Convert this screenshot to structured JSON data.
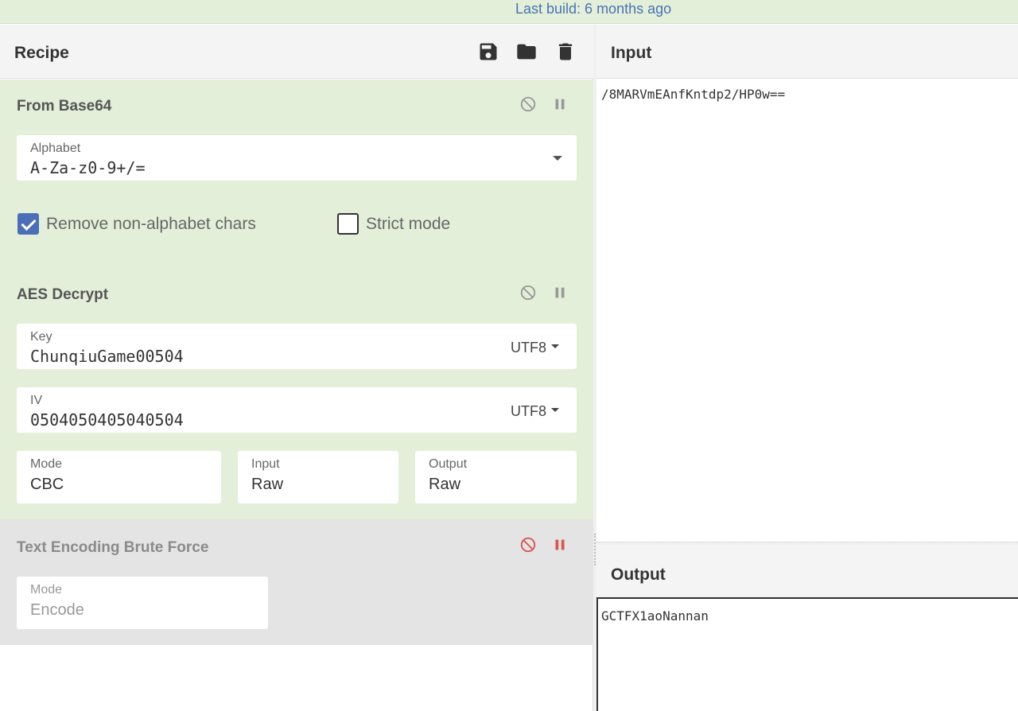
{
  "banner": {
    "last_build": "Last build: 6 months ago"
  },
  "recipe": {
    "title": "Recipe",
    "icons": [
      "save-icon",
      "folder-icon",
      "trash-icon"
    ],
    "operations": {
      "from_base64": {
        "title": "From Base64",
        "alphabet_label": "Alphabet",
        "alphabet_value": "A-Za-z0-9+/=",
        "remove_non_alpha_label": "Remove non-alphabet chars",
        "remove_non_alpha_checked": true,
        "strict_mode_label": "Strict mode",
        "strict_mode_checked": false
      },
      "aes_decrypt": {
        "title": "AES Decrypt",
        "key_label": "Key",
        "key_value": "ChunqiuGame00504",
        "key_encoding": "UTF8",
        "iv_label": "IV",
        "iv_value": "0504050405040504",
        "iv_encoding": "UTF8",
        "mode_label": "Mode",
        "mode_value": "CBC",
        "input_label": "Input",
        "input_value": "Raw",
        "output_label": "Output",
        "output_value": "Raw"
      },
      "text_encoding_brute_force": {
        "title": "Text Encoding Brute Force",
        "mode_label": "Mode",
        "mode_value": "Encode",
        "disabled": true
      }
    }
  },
  "input": {
    "title": "Input",
    "text": "/8MARVmEAnfKntdp2/HP0w=="
  },
  "output": {
    "title": "Output",
    "text": "GCTFX1aoNannan"
  },
  "colors": {
    "active_op_bg": "#e3efd9",
    "disabled_op_bg": "#e4e4e4",
    "disabled_ctrl": "#d9534f",
    "link_blue": "#4a73b4",
    "checkbox_blue": "#4a6fb8"
  }
}
